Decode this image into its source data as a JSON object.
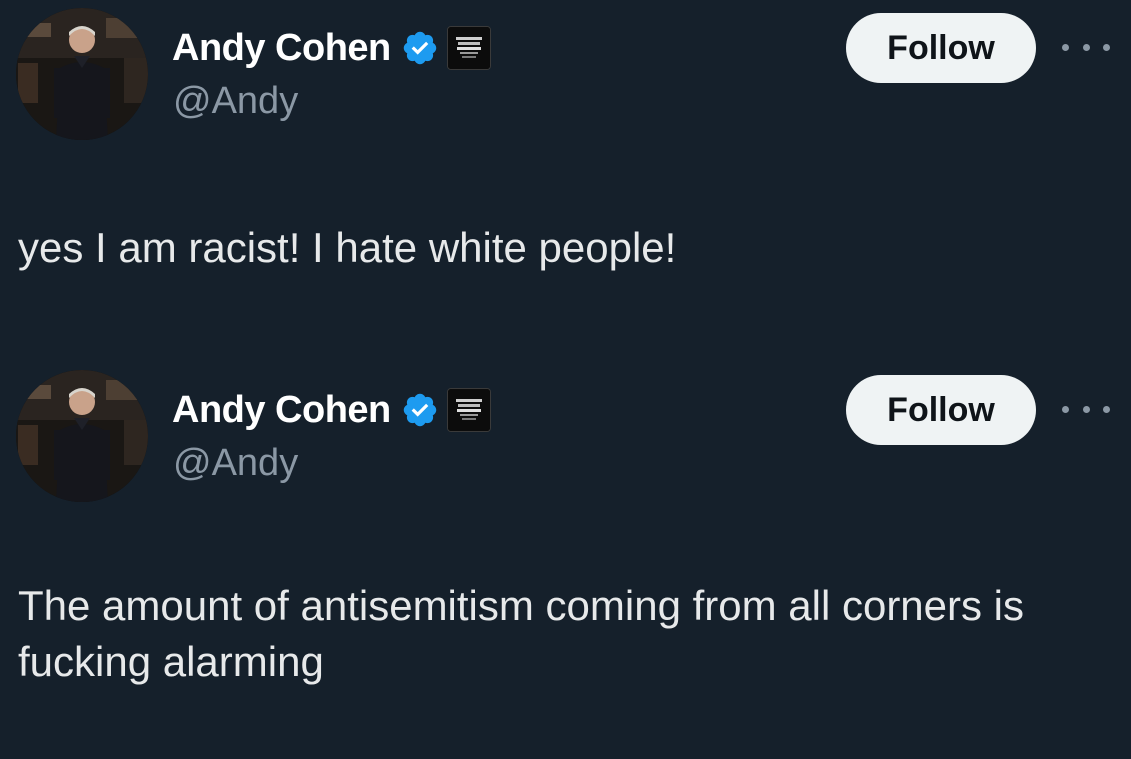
{
  "tweets": [
    {
      "display_name": "Andy Cohen",
      "handle": "@Andy",
      "follow_label": "Follow",
      "text": "yes I am racist! I hate white people!",
      "verified_icon": "verified-badge-icon",
      "more_icon": "more-options-icon"
    },
    {
      "display_name": "Andy Cohen",
      "handle": "@Andy",
      "follow_label": "Follow",
      "text": "The amount of antisemitism coming from all corners is fucking alarming",
      "verified_icon": "verified-badge-icon",
      "more_icon": "more-options-icon"
    }
  ],
  "colors": {
    "background": "#15202b",
    "verified_blue": "#1d9bf0",
    "follow_button": "#eff3f4",
    "secondary_text": "#8b98a5"
  }
}
